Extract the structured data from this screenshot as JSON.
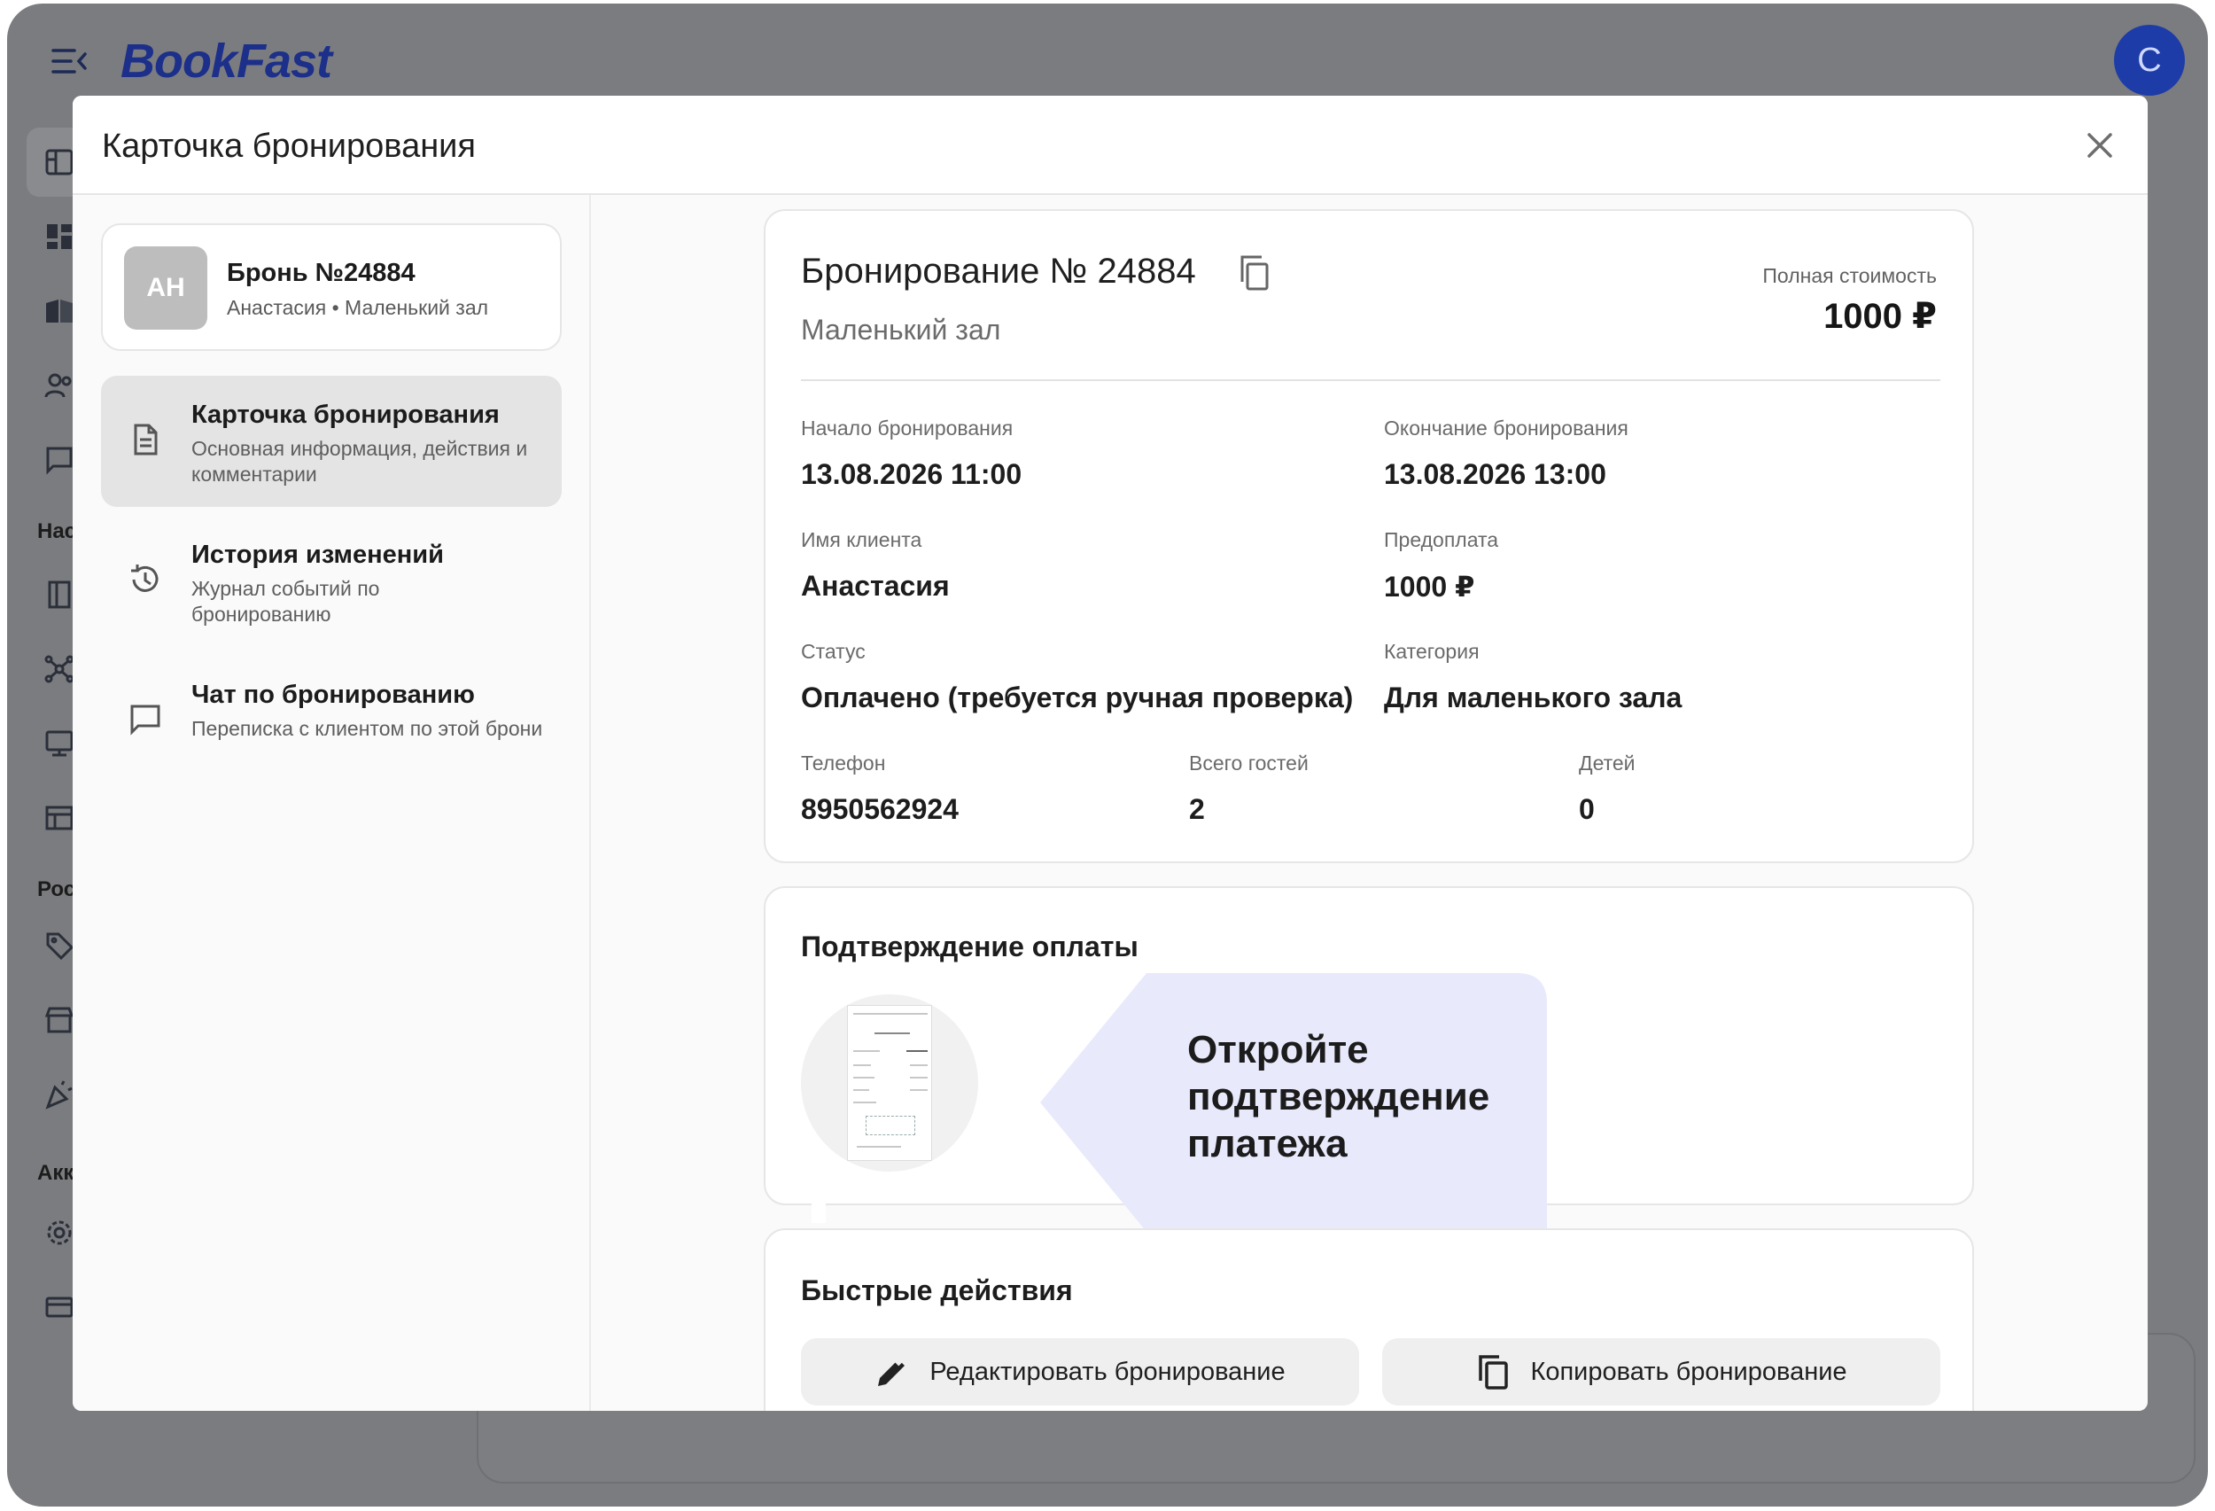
{
  "app": {
    "brand": "BookFast",
    "user_initial": "С",
    "rail_sections": [
      "Нас",
      "Рос",
      "Акк"
    ]
  },
  "modal": {
    "title": "Карточка бронирования",
    "close_icon": "close-icon"
  },
  "sidebar": {
    "booking": {
      "initials": "АН",
      "title": "Бронь №24884",
      "subtitle": "Анастасия • Маленький зал"
    },
    "items": [
      {
        "title": "Карточка бронирования",
        "subtitle": "Основная информация, действия и комментарии",
        "icon": "document-icon",
        "active": true
      },
      {
        "title": "История изменений",
        "subtitle": "Журнал событий по бронированию",
        "icon": "history-icon",
        "active": false
      },
      {
        "title": "Чат по бронированию",
        "subtitle": "Переписка с клиентом по этой брони",
        "icon": "chat-icon",
        "active": false
      }
    ]
  },
  "booking": {
    "title": "Бронирование № 24884",
    "hall": "Маленький зал",
    "total_label": "Полная стоимость",
    "total_value": "1000 ₽",
    "fields": {
      "start_label": "Начало бронирования",
      "start_value": "13.08.2026 11:00",
      "end_label": "Окончание бронирования",
      "end_value": "13.08.2026 13:00",
      "client_label": "Имя клиента",
      "client_value": "Анастасия",
      "prepay_label": "Предоплата",
      "prepay_value": "1000 ₽",
      "status_label": "Статус",
      "status_value": "Оплачено (требуется ручная проверка)",
      "category_label": "Категория",
      "category_value": "Для маленького зала",
      "phone_label": "Телефон",
      "phone_value": "8950562924",
      "guests_label": "Всего гостей",
      "guests_value": "2",
      "children_label": "Детей",
      "children_value": "0"
    }
  },
  "payment": {
    "title": "Подтверждение оплаты",
    "tooltip": "Откройте подтверждение платежа"
  },
  "actions": {
    "title": "Быстрые действия",
    "edit_label": "Редактировать бронирование",
    "copy_label": "Копировать бронирование"
  },
  "colors": {
    "brand": "#1c2f8a",
    "overlay": "#7b7c7f",
    "tooltip_bg": "#e8eafc",
    "avatar_bg": "#1e3ca8"
  }
}
